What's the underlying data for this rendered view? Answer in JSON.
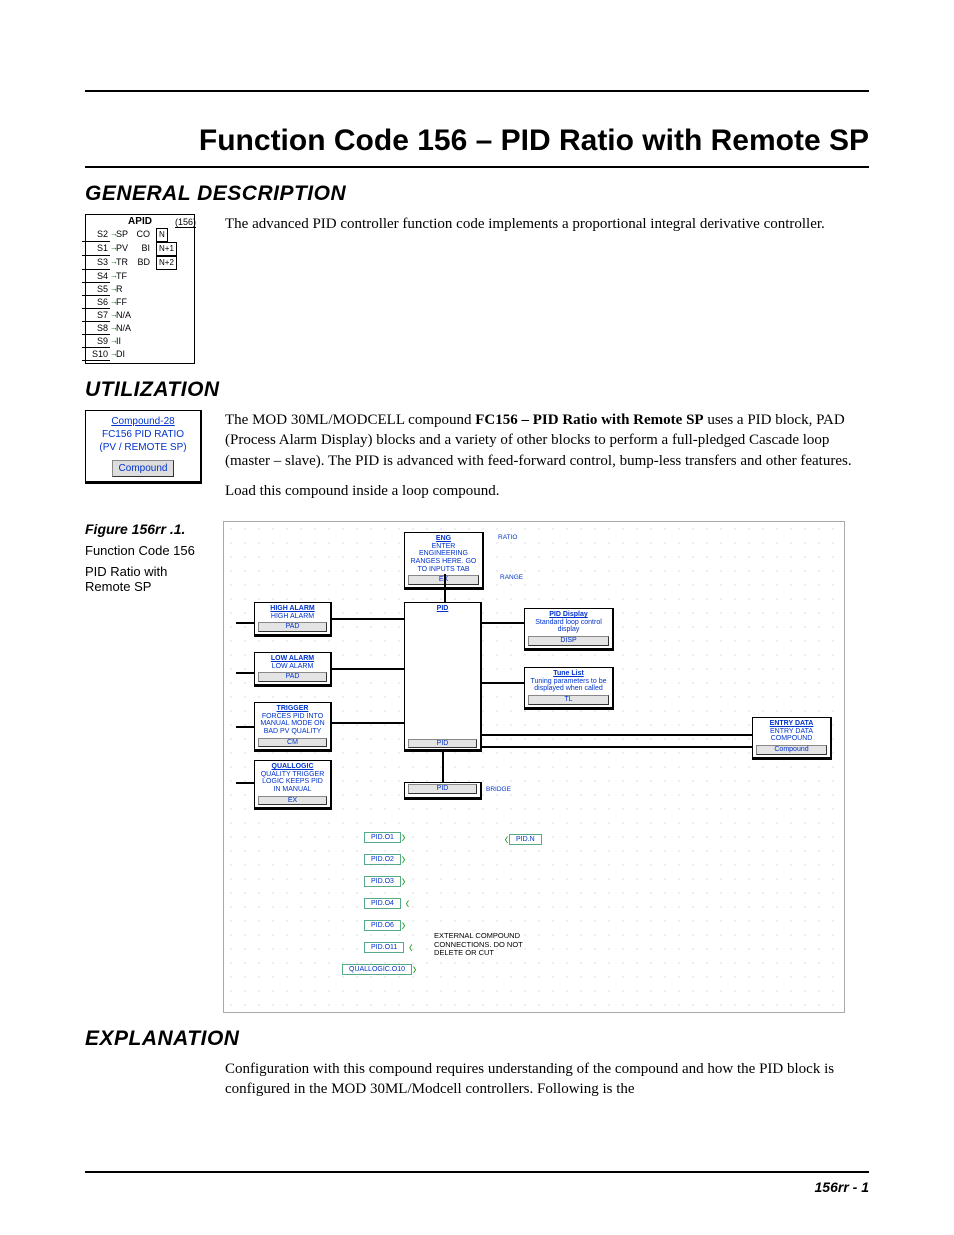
{
  "page_title": "Function Code 156 – PID Ratio with Remote SP",
  "footer": "156rr - 1",
  "sections": {
    "general": {
      "heading": "GENERAL DESCRIPTION",
      "body": "The advanced PID controller function code implements a proportional integral derivative controller."
    },
    "utilization": {
      "heading": "UTILIZATION",
      "p1_a": "The MOD 30ML/MODCELL compound ",
      "p1_bold": "FC156 – PID Ratio with Remote SP",
      "p1_b": " uses a PID block, PAD (Process Alarm Display) blocks and a variety of other blocks to perform a full-pledged Cascade loop (master – slave). The PID is advanced with feed-forward control, bump-less transfers and other features.",
      "p2": "Load this compound inside a loop compound."
    },
    "explanation": {
      "heading": "EXPLANATION",
      "body": "Configuration with this compound requires understanding of the compound and how the PID block is configured in the MOD 30ML/Modcell controllers. Following is the"
    }
  },
  "apid": {
    "title": "APID",
    "code": "(156)",
    "rows": [
      {
        "sig": "S2",
        "lab": "SP",
        "out": "CO",
        "outbox": "N"
      },
      {
        "sig": "S1",
        "lab": "PV",
        "out": "BI",
        "outbox": "N+1"
      },
      {
        "sig": "S3",
        "lab": "TR",
        "out": "BD",
        "outbox": "N+2"
      },
      {
        "sig": "S4",
        "lab": "TF",
        "out": "",
        "outbox": ""
      },
      {
        "sig": "S5",
        "lab": "R",
        "out": "",
        "outbox": ""
      },
      {
        "sig": "S6",
        "lab": "FF",
        "out": "",
        "outbox": ""
      },
      {
        "sig": "S7",
        "lab": "N/A",
        "out": "",
        "outbox": ""
      },
      {
        "sig": "S8",
        "lab": "N/A",
        "out": "",
        "outbox": ""
      },
      {
        "sig": "S9",
        "lab": "II",
        "out": "",
        "outbox": ""
      },
      {
        "sig": "S10",
        "lab": "DI",
        "out": "",
        "outbox": ""
      }
    ]
  },
  "compound_box": {
    "line1": "Compound-28",
    "line2": "FC156 PID RATIO",
    "line3": "(PV / REMOTE SP)",
    "button": "Compound"
  },
  "figure": {
    "number": "Figure 156rr .1.",
    "line1": "Function Code 156",
    "line2": "PID Ratio with Remote SP"
  },
  "diagram": {
    "eng": {
      "hdr": "ENG",
      "body": "ENTER ENGINEERING RANGES HERE. GO TO INPUTS TAB",
      "btn": "EX"
    },
    "hi": {
      "hdr": "HIGH ALARM",
      "body": "HIGH ALARM",
      "btn": "PAD"
    },
    "lo": {
      "hdr": "LOW ALARM",
      "body": "LOW ALARM",
      "btn": "PAD"
    },
    "trg": {
      "hdr": "TRIGGER",
      "body": "FORCES PID INTO MANUAL MODE ON BAD PV QUALITY",
      "btn": "CM"
    },
    "qual": {
      "hdr": "QUALLOGIC",
      "body": "QUALITY TRIGGER LOGIC KEEPS PID IN MANUAL",
      "btn": "EX"
    },
    "pid_main": {
      "hdr": "PID",
      "btn": "PID"
    },
    "disp": {
      "hdr": "PID Display",
      "body": "Standard loop control display",
      "btn": "DISP"
    },
    "tune": {
      "hdr": "Tune List",
      "body": "Tuning parameters to be displayed when called",
      "btn": "TL"
    },
    "entry": {
      "hdr": "ENTRY DATA",
      "body": "ENTRY DATA COMPOUND",
      "btn": "Compound"
    },
    "pid_bridge_btn": "PID",
    "tags": [
      "PID.O1",
      "PID.O2",
      "PID.O3",
      "PID.O4",
      "PID.O6",
      "PID.O11",
      "QUALLOGIC.O10"
    ],
    "pid_n": "PID.N",
    "ext_note_l1": "EXTERNAL COMPOUND",
    "ext_note_l2": "CONNECTIONS. DO NOT",
    "ext_note_l3": "DELETE OR CUT",
    "lab_bridge": "BRIDGE",
    "lab_range": "RANGE",
    "lab_ratio": "RATIO"
  }
}
